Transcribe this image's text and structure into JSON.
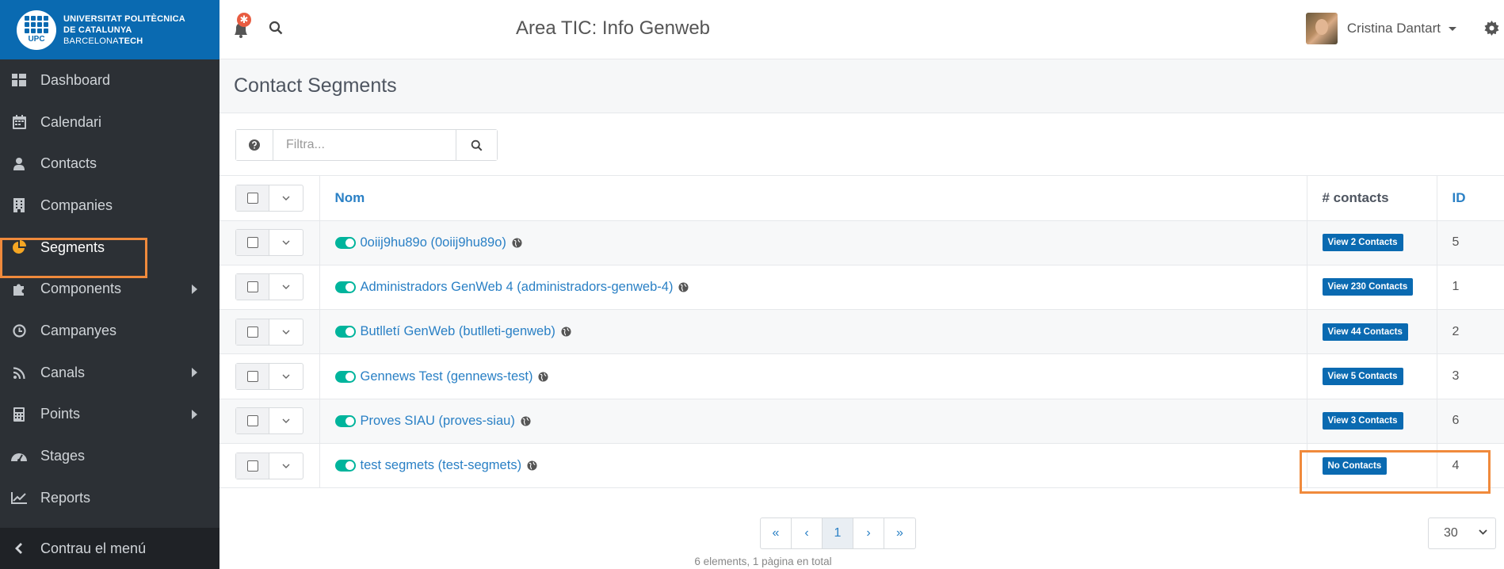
{
  "brand": {
    "line1": "UNIVERSITAT POLITÈCNICA",
    "line2": "DE CATALUNYA",
    "line3_a": "BARCELONA",
    "line3_b": "TECH",
    "mark": "UPC",
    "color": "#0a6ab1"
  },
  "sidebar": {
    "items": [
      {
        "label": "Dashboard",
        "icon": "dashboard-icon"
      },
      {
        "label": "Calendari",
        "icon": "calendar-icon"
      },
      {
        "label": "Contacts",
        "icon": "user-icon"
      },
      {
        "label": "Companies",
        "icon": "building-icon"
      },
      {
        "label": "Segments",
        "icon": "pie-chart-icon"
      },
      {
        "label": "Components",
        "icon": "puzzle-icon"
      },
      {
        "label": "Campanyes",
        "icon": "clock-icon"
      },
      {
        "label": "Canals",
        "icon": "rss-icon"
      },
      {
        "label": "Points",
        "icon": "calculator-icon"
      },
      {
        "label": "Stages",
        "icon": "tachometer-icon"
      },
      {
        "label": "Reports",
        "icon": "line-chart-icon"
      }
    ],
    "collapse_label": "Contrau el menú"
  },
  "topbar": {
    "notif_badge": "✱",
    "title": "Area TIC: Info Genweb",
    "user_name": "Cristina Dantart"
  },
  "page": {
    "title": "Contact Segments"
  },
  "filter": {
    "placeholder": "Filtra..."
  },
  "table": {
    "headers": {
      "name": "Nom",
      "contacts": "# contacts",
      "id": "ID"
    },
    "rows": [
      {
        "name": "0oiij9hu89o (0oiij9hu89o)",
        "contacts": "View 2 Contacts",
        "id": "5"
      },
      {
        "name": "Administradors GenWeb 4 (administradors-genweb-4)",
        "contacts": "View 230 Contacts",
        "id": "1"
      },
      {
        "name": "Butlletí GenWeb (butlleti-genweb)",
        "contacts": "View 44 Contacts",
        "id": "2"
      },
      {
        "name": "Gennews Test (gennews-test)",
        "contacts": "View 5 Contacts",
        "id": "3"
      },
      {
        "name": "Proves SIAU (proves-siau)",
        "contacts": "View 3 Contacts",
        "id": "6"
      },
      {
        "name": "test segmets (test-segmets)",
        "contacts": "No Contacts",
        "id": "4"
      }
    ]
  },
  "pagination": {
    "first": "«",
    "prev": "‹",
    "current": "1",
    "next": "›",
    "last": "»",
    "info": "6 elements, 1 pàgina en total",
    "per_page": "30"
  },
  "colors": {
    "sidebar_bg": "#2c3035",
    "link": "#2a80c5",
    "toggle_on": "#00b49c",
    "badge": "#0a6ab1",
    "highlight": "#f08a3c"
  }
}
